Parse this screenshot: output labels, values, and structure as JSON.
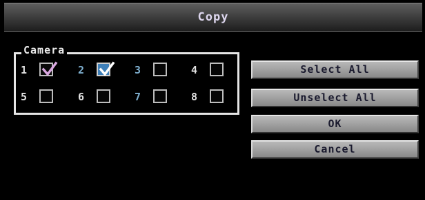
{
  "dialog": {
    "title": "Copy"
  },
  "camera_group": {
    "label": "Camera",
    "cameras": [
      {
        "number": "1",
        "checked": true
      },
      {
        "number": "2",
        "checked": true
      },
      {
        "number": "3",
        "checked": false
      },
      {
        "number": "4",
        "checked": false
      },
      {
        "number": "5",
        "checked": false
      },
      {
        "number": "6",
        "checked": false
      },
      {
        "number": "7",
        "checked": false
      },
      {
        "number": "8",
        "checked": false
      }
    ]
  },
  "buttons": {
    "select_all": "Select All",
    "unselect_all": "Unselect All",
    "ok": "OK",
    "cancel": "Cancel"
  },
  "colors": {
    "background": "#000000",
    "title_text": "#ddd6ee",
    "button_face": "#9c9c9c",
    "focused_checkbox": "#3e7fb8",
    "check_mark_first": "#d9a7e0",
    "check_mark_focused": "#ffffff"
  }
}
